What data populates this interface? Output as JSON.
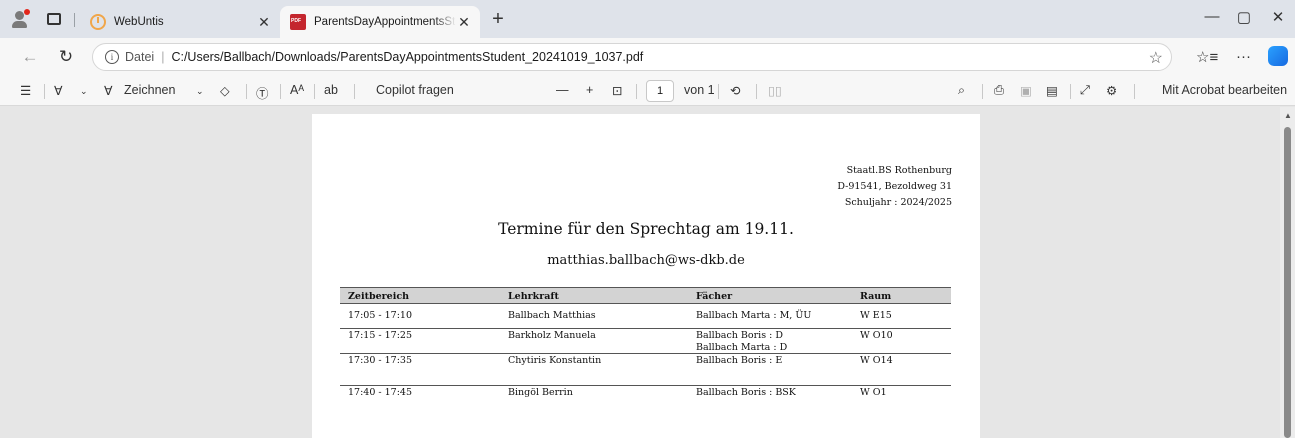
{
  "browser": {
    "tabs": [
      {
        "title": "WebUntis",
        "active": false
      },
      {
        "title": "ParentsDayAppointmentsStudent",
        "active": true
      }
    ],
    "address": {
      "info_label": "Datei",
      "url": "C:/Users/Ballbach/Downloads/ParentsDayAppointmentsStudent_20241019_1037.pdf"
    }
  },
  "pdf_toolbar": {
    "draw_label": "Zeichnen",
    "read_aloud_label": "Aᴬ",
    "translate_label": "ab",
    "copilot_label": "Copilot fragen",
    "page_current": "1",
    "page_total_label": "von 1",
    "acrobat_label": "Mit Acrobat bearbeiten"
  },
  "document": {
    "school_lines": [
      "Staatl.BS Rothenburg",
      "D-91541, Bezoldweg 31",
      "Schuljahr :  2024/2025"
    ],
    "title": "Termine für den Sprechtag am 19.11.",
    "email": "matthias.ballbach@ws-dkb.de",
    "table": {
      "headers": [
        "Zeitbereich",
        "Lehrkraft",
        "Fächer",
        "Raum"
      ],
      "rows": [
        {
          "time": "17:05 - 17:10",
          "teacher": "Ballbach Matthias",
          "subjects": [
            "Ballbach Marta : M, ÜU"
          ],
          "room": "W E15"
        },
        {
          "time": "17:15 - 17:25",
          "teacher": "Barkholz Manuela",
          "subjects": [
            "Ballbach Boris : D",
            "Ballbach Marta : D"
          ],
          "room": "W O10"
        },
        {
          "time": "17:30 - 17:35",
          "teacher": "Chytiris Konstantin",
          "subjects": [
            "Ballbach Boris : E"
          ],
          "room": "W O14"
        },
        {
          "time": "17:40 - 17:45",
          "teacher": "Bingöl Berrin",
          "subjects": [
            "Ballbach Boris : BSK"
          ],
          "room": "W O1"
        }
      ]
    }
  },
  "colors": {
    "pdf_red": "#c4262e",
    "copilot_blue": "#1769e0",
    "header_gray": "#d3d3d3"
  }
}
